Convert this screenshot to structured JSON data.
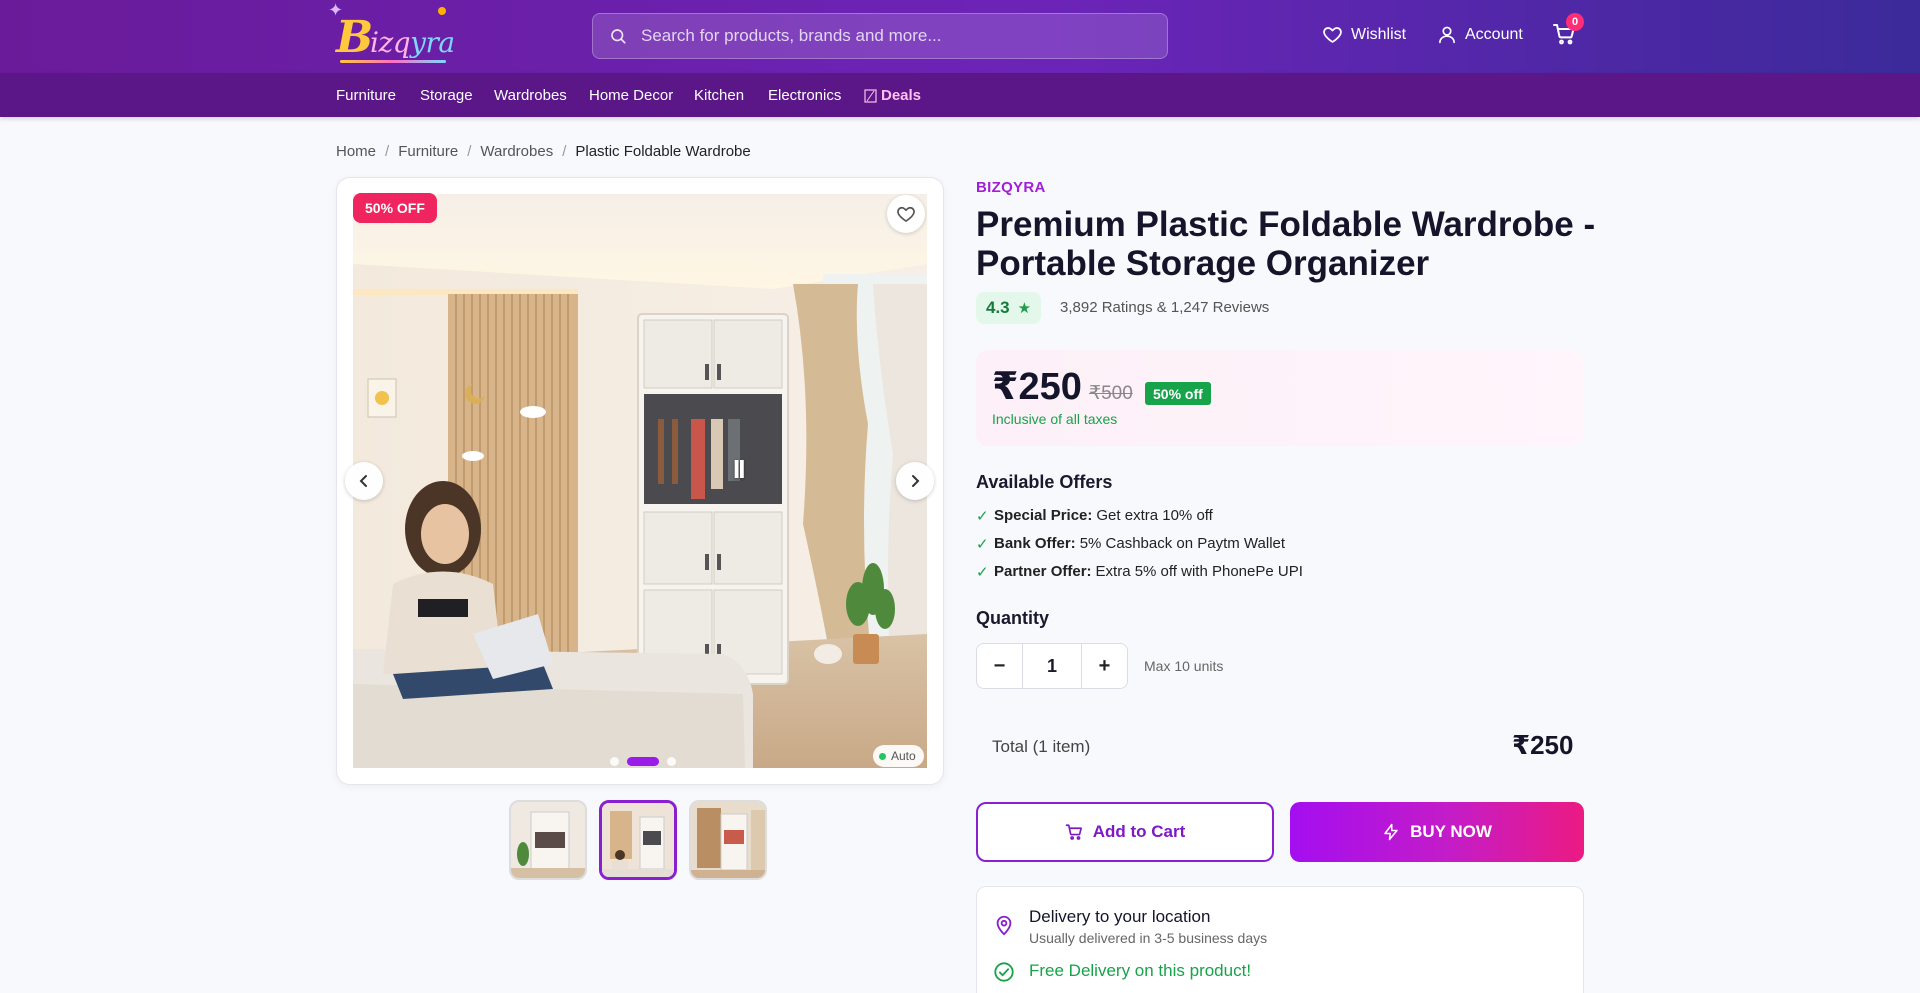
{
  "header": {
    "logo_initial": "B",
    "logo_rest_a": "izq",
    "logo_rest_b": "yra",
    "search_placeholder": "Search for products, brands and more...",
    "wishlist_label": "Wishlist",
    "account_label": "Account",
    "cart_count": "0"
  },
  "categories": [
    "Furniture",
    "Storage",
    "Wardrobes",
    "Home Decor",
    "Kitchen",
    "Electronics"
  ],
  "deals_label": "Deals",
  "breadcrumb": {
    "items": [
      "Home",
      "Furniture",
      "Wardrobes"
    ],
    "separator": "/",
    "current": "Plastic Foldable Wardrobe"
  },
  "gallery": {
    "discount_badge": "50% OFF",
    "pause_symbol": "II",
    "auto_label": "Auto",
    "slide_count": 3,
    "active_slide": 2,
    "thumbnail_count": 3,
    "selected_thumbnail": 2
  },
  "product": {
    "brand": "BIZQYRA",
    "title": "Premium Plastic Foldable Wardrobe - Portable Storage Organizer",
    "rating": "4.3",
    "rating_text": "3,892 Ratings & 1,247 Reviews",
    "price": "₹250",
    "mrp": "₹500",
    "discount": "50% off",
    "tax_note": "Inclusive of all taxes"
  },
  "offers": {
    "heading": "Available Offers",
    "items": [
      {
        "label": "Special Price:",
        "text": "Get extra 10% off"
      },
      {
        "label": "Bank Offer:",
        "text": "5% Cashback on Paytm Wallet"
      },
      {
        "label": "Partner Offer:",
        "text": "Extra 5% off with PhonePe UPI"
      }
    ],
    "tick": "✓"
  },
  "quantity": {
    "heading": "Quantity",
    "minus": "−",
    "value": "1",
    "plus": "+",
    "max_note": "Max 10 units"
  },
  "total": {
    "label": "Total (1 item)",
    "value": "₹250"
  },
  "actions": {
    "add_to_cart": "Add to Cart",
    "buy_now": "BUY NOW"
  },
  "delivery": {
    "title": "Delivery to your location",
    "subtitle": "Usually delivered in 3-5 business days",
    "free": "Free Delivery on this product!"
  },
  "colors": {
    "header_purple": "#6a1b9a",
    "category_bar": "#5b1687",
    "accent_purple": "#8a1fd1",
    "sale_pink": "#f0245e",
    "success_green": "#16a34a"
  }
}
